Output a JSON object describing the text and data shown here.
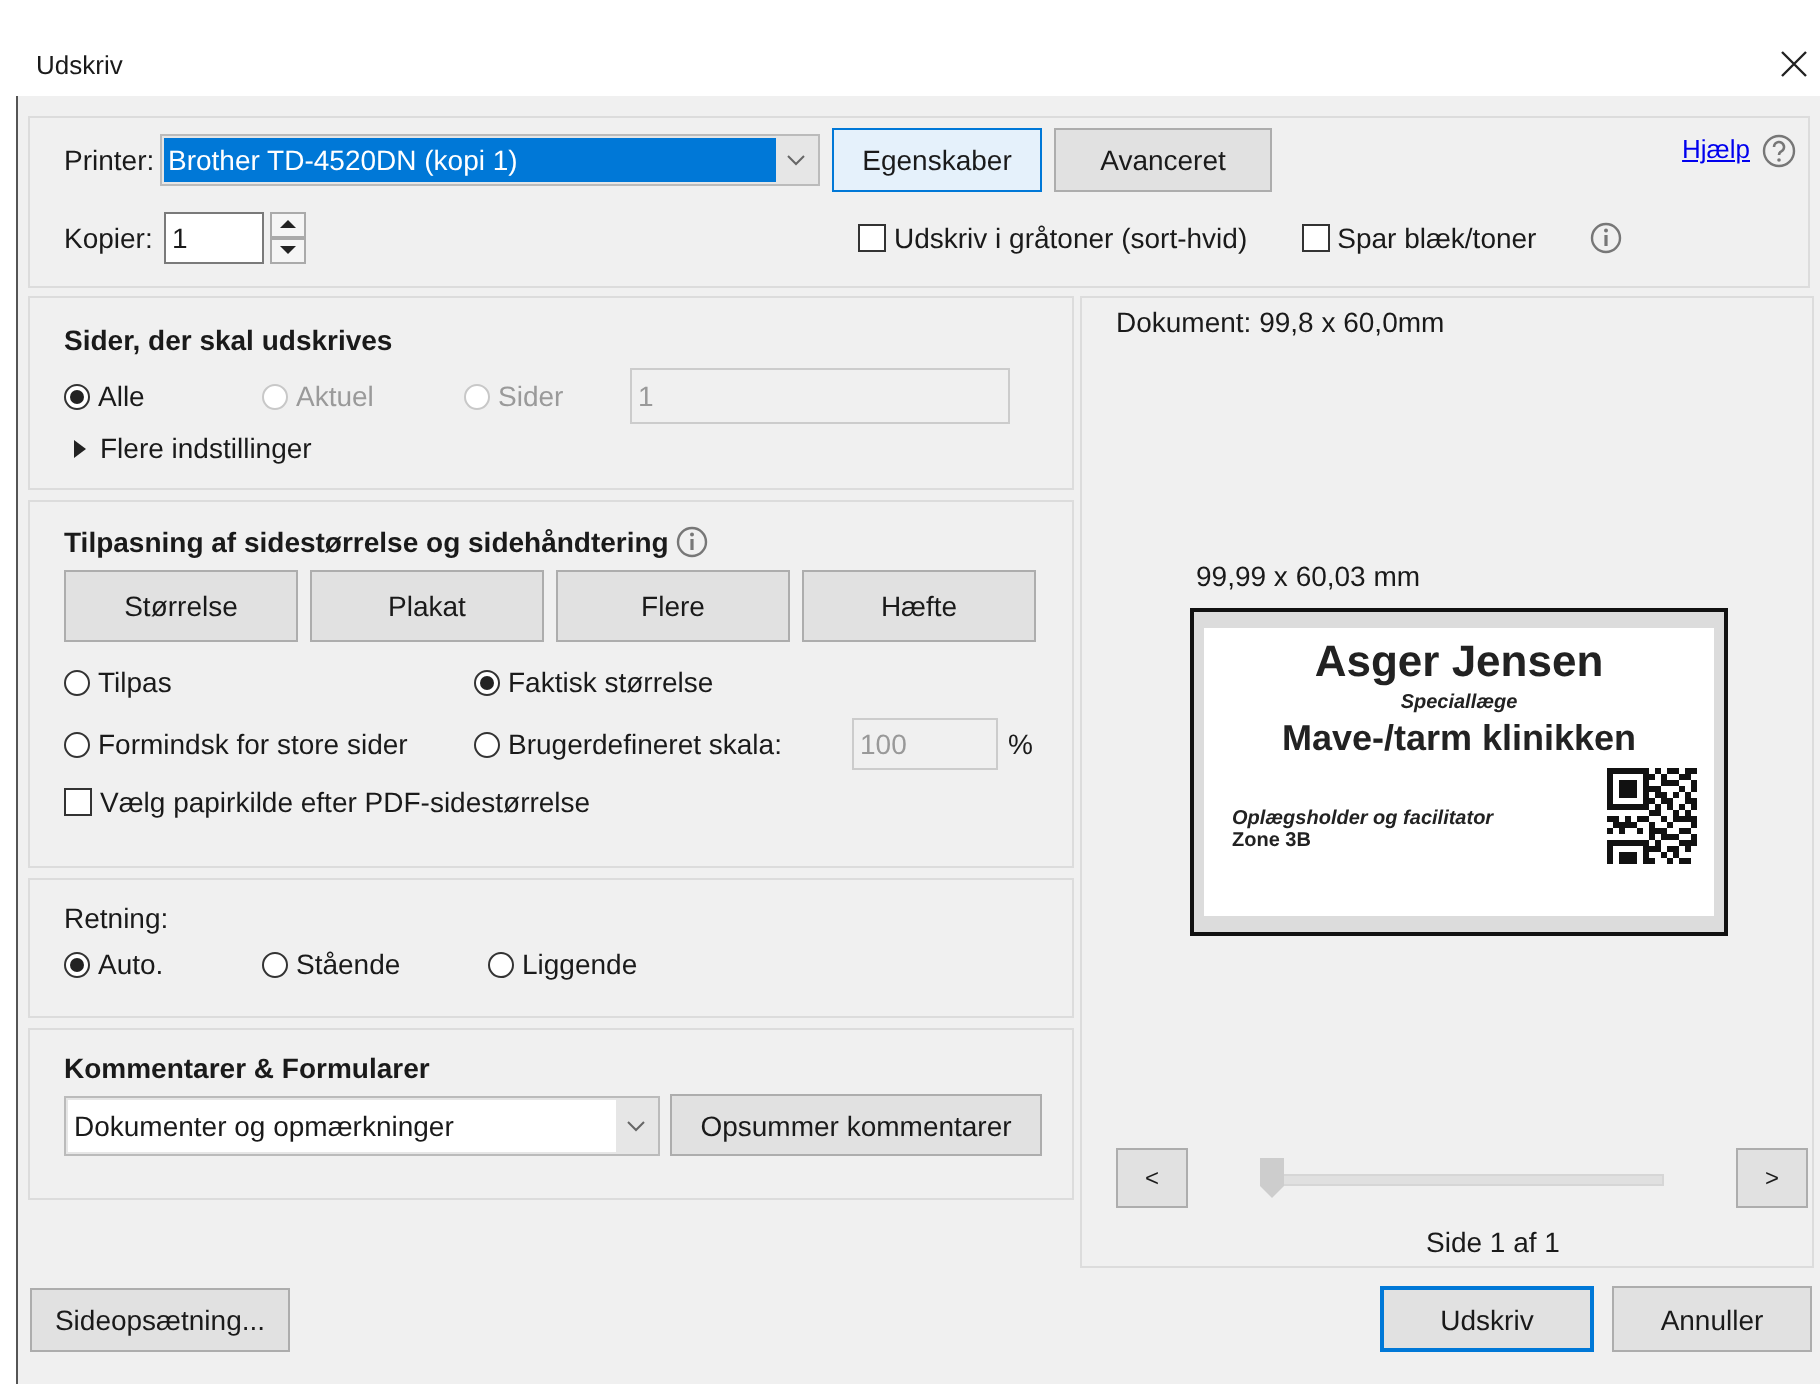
{
  "window": {
    "title": "Udskriv"
  },
  "printer": {
    "label": "Printer:",
    "value": "Brother TD-4520DN (kopi 1)",
    "selected": true
  },
  "top_buttons": [
    "Egenskaber",
    "Avanceret"
  ],
  "help": {
    "label": "Hjælp"
  },
  "copies": {
    "label": "Kopier:",
    "value": "1"
  },
  "top_options": [
    {
      "label": "Udskriv i gråtoner (sort-hvid)",
      "checked": false
    },
    {
      "label": "Spar blæk/toner",
      "checked": false
    }
  ],
  "pages": {
    "title": "Sider, der skal udskrives",
    "options": [
      {
        "label": "Alle",
        "selected": true,
        "disabled": false
      },
      {
        "label": "Aktuel",
        "selected": false,
        "disabled": true
      },
      {
        "label": "Sider",
        "selected": false,
        "disabled": true
      }
    ],
    "range": {
      "value": "1",
      "disabled": true
    },
    "more": {
      "label": "Flere indstillinger",
      "expanded": false
    }
  },
  "sizing": {
    "title": "Tilpasning af sidestørrelse og sidehåndtering",
    "modes": [
      "Størrelse",
      "Plakat",
      "Flere",
      "Hæfte"
    ],
    "options": [
      {
        "label": "Tilpas",
        "selected": false
      },
      {
        "label": "Faktisk størrelse",
        "selected": true
      },
      {
        "label": "Formindsk for store sider",
        "selected": false
      },
      {
        "label": "Brugerdefineret skala:",
        "selected": false
      }
    ],
    "scale": {
      "value": "100",
      "unit": "%",
      "disabled": true
    },
    "paper_source": {
      "label": "Vælg papirkilde efter PDF-sidestørrelse",
      "checked": false
    }
  },
  "orientation": {
    "title": "Retning:",
    "options": [
      {
        "label": "Auto.",
        "selected": true
      },
      {
        "label": "Stående",
        "selected": false
      },
      {
        "label": "Liggende",
        "selected": false
      }
    ]
  },
  "comments": {
    "title": "Kommentarer & Formularer",
    "value": "Dokumenter og opmærkninger",
    "button": "Opsummer kommentarer"
  },
  "preview": {
    "document_size": "Dokument: 99,8 x 60,0mm",
    "paper_size": "99,99 x 60,03 mm",
    "label_lines": [
      {
        "text": "Asger Jensen",
        "kind": "title"
      },
      {
        "text": "Speciallæge",
        "kind": "subtitle"
      },
      {
        "text": "Mave-/tarm klinikken",
        "kind": "heading"
      },
      {
        "text": "Oplægsholder og facilitator",
        "kind": "note"
      },
      {
        "text": "Zone 3B",
        "kind": "footer"
      }
    ],
    "prev": "<",
    "next": ">",
    "slider": {
      "level": 0
    },
    "page": "Side 1 af 1"
  },
  "footer": {
    "page_setup": "Sideopsætning...",
    "print": "Udskriv",
    "cancel": "Annuller"
  }
}
